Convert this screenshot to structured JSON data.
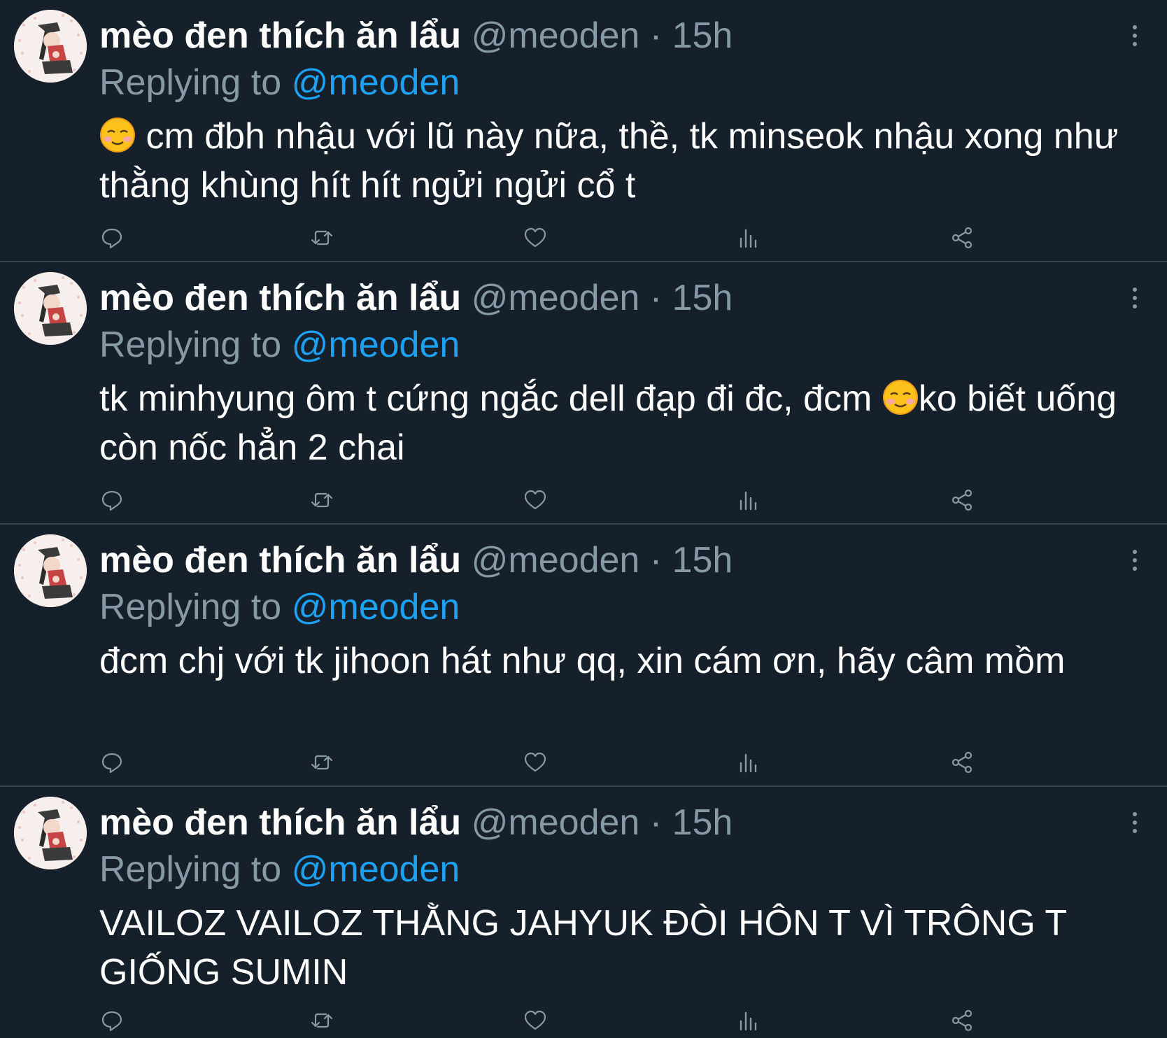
{
  "theme": {
    "background": "#15202b",
    "divider": "#38444d",
    "text_primary": "#ffffff",
    "text_secondary": "#8899a6",
    "accent": "#1da1f2"
  },
  "tweets": [
    {
      "display_name": "mèo đen thích ăn lẩu",
      "handle": "@meoden",
      "separator": "·",
      "time": "15h",
      "replying_prefix": "Replying to",
      "replying_handle": "@meoden",
      "text_before_emoji": "",
      "emoji": "smiling-face-icon",
      "text_after_emoji": " cm đbh nhậu với lũ này nữa, thề, tk minseok nhậu xong như thằng khùng hít hít ngửi ngửi cổ t"
    },
    {
      "display_name": "mèo đen thích ăn lẩu",
      "handle": "@meoden",
      "separator": "·",
      "time": "15h",
      "replying_prefix": "Replying to",
      "replying_handle": "@meoden",
      "text_before_emoji": "tk minhyung ôm t cứng ngắc dell đạp đi đc, đcm ",
      "emoji": "smiling-face-icon",
      "text_after_emoji": "ko biết uống còn nốc hẳn 2 chai"
    },
    {
      "display_name": "mèo đen thích ăn lẩu",
      "handle": "@meoden",
      "separator": "·",
      "time": "15h",
      "replying_prefix": "Replying to",
      "replying_handle": "@meoden",
      "text_before_emoji": "đcm chj với tk jihoon hát như qq, xin cám ơn, hãy câm mồm",
      "emoji": "",
      "text_after_emoji": ""
    },
    {
      "display_name": "mèo đen thích ăn lẩu",
      "handle": "@meoden",
      "separator": "·",
      "time": "15h",
      "replying_prefix": "Replying to",
      "replying_handle": "@meoden",
      "text_before_emoji": "VAILOZ VAILOZ THẰNG JAHYUK ĐÒI HÔN T VÌ TRÔNG T GIỐNG SUMIN",
      "emoji": "",
      "text_after_emoji": ""
    }
  ],
  "action_icons": [
    "reply-icon",
    "retweet-icon",
    "like-icon",
    "analytics-icon",
    "share-icon"
  ]
}
